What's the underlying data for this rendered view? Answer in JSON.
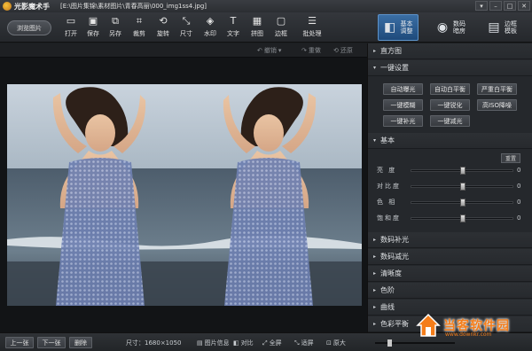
{
  "window": {
    "app_name": "光影魔术手",
    "file_path": "[E:\\图片集锦\\素材图片\\青春高丽\\000_img1ss4.jpg]",
    "controls": [
      "▾",
      "–",
      "□",
      "✕"
    ]
  },
  "toolbar": {
    "browse_label": "浏览图片",
    "tools": [
      {
        "label": "打开",
        "icon": "open-icon",
        "glyph": "▭"
      },
      {
        "label": "保存",
        "icon": "save-icon",
        "glyph": "▣"
      },
      {
        "label": "另存",
        "icon": "save-as-icon",
        "glyph": "⧉"
      },
      {
        "label": "裁剪",
        "icon": "crop-icon",
        "glyph": "⌗"
      },
      {
        "label": "旋转",
        "icon": "rotate-icon",
        "glyph": "⟲"
      },
      {
        "label": "尺寸",
        "icon": "resize-icon",
        "glyph": "⤡"
      },
      {
        "label": "水印",
        "icon": "watermark-icon",
        "glyph": "◈"
      },
      {
        "label": "文字",
        "icon": "text-icon",
        "glyph": "T"
      },
      {
        "label": "拼图",
        "icon": "collage-icon",
        "glyph": "▦"
      },
      {
        "label": "边框",
        "icon": "frame-icon",
        "glyph": "▢"
      },
      {
        "label": "批处理",
        "icon": "batch-icon",
        "glyph": "☰"
      }
    ],
    "modes": [
      {
        "label_line1": "基本",
        "label_line2": "调整",
        "icon": "basic-adjust-icon",
        "glyph": "◧",
        "active": true
      },
      {
        "label_line1": "数码",
        "label_line2": "暗房",
        "icon": "camera-icon",
        "glyph": "◉",
        "active": false
      },
      {
        "label_line1": "边框",
        "label_line2": "模板",
        "icon": "template-icon",
        "glyph": "▤",
        "active": false
      }
    ]
  },
  "history": {
    "undo": "撤销",
    "redo": "重做",
    "restore": "还原"
  },
  "panel": {
    "histogram": "直方图",
    "one_click": {
      "title": "一键设置",
      "buttons": [
        "自动曝光",
        "自动白平衡",
        "严重白平衡",
        "一键模糊",
        "一键锐化",
        "高ISO降噪",
        "一键补光",
        "一键减光"
      ]
    },
    "basic": {
      "title": "基本",
      "reset": "重置",
      "sliders": [
        {
          "name": "亮  度",
          "value": 0,
          "position": 0.5
        },
        {
          "name": "对比度",
          "value": 0,
          "position": 0.5
        },
        {
          "name": "色  相",
          "value": 0,
          "position": 0.5
        },
        {
          "name": "饱和度",
          "value": 0,
          "position": 0.5
        }
      ]
    },
    "sections": [
      "数码补光",
      "数码减光",
      "清晰度",
      "色阶",
      "曲线",
      "色彩平衡"
    ]
  },
  "bottom": {
    "prev": "上一张",
    "next": "下一张",
    "delete": "删除",
    "size": "尺寸：1680×1050",
    "info": "图片信息",
    "compare": "对比",
    "fullscreen": "全屏",
    "fit": "适屏",
    "original": "原大",
    "zoom_position": 0.15
  },
  "watermark": {
    "text": "当客软件园",
    "url": "www.downkr.com"
  }
}
